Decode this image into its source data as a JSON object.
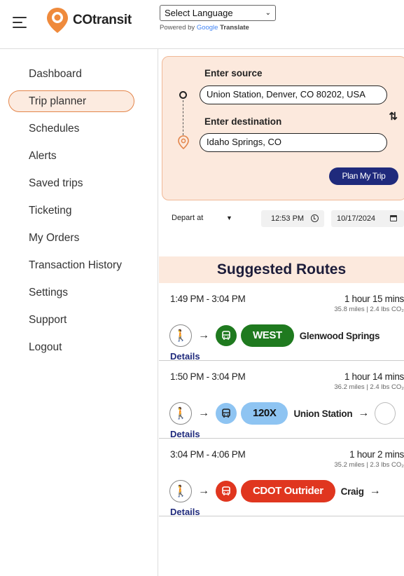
{
  "header": {
    "brand": "COtransit",
    "language_select": "Select Language",
    "powered_by": "Powered by",
    "google": "Google",
    "translate": "Translate"
  },
  "sidebar": {
    "items": [
      {
        "label": "Dashboard"
      },
      {
        "label": "Trip planner",
        "active": true
      },
      {
        "label": "Schedules"
      },
      {
        "label": "Alerts"
      },
      {
        "label": "Saved trips"
      },
      {
        "label": "Ticketing"
      },
      {
        "label": "My Orders"
      },
      {
        "label": "Transaction History"
      },
      {
        "label": "Settings"
      },
      {
        "label": "Support"
      },
      {
        "label": "Logout"
      }
    ]
  },
  "planner": {
    "source_label": "Enter source",
    "source_value": "Union Station, Denver, CO 80202, USA",
    "destination_label": "Enter destination",
    "destination_value": "Idaho Springs, CO",
    "swap_icon": "⇅",
    "plan_button": "Plan My Trip",
    "depart_option": "Depart at",
    "time": "12:53 PM",
    "date": "10/17/2024"
  },
  "suggested_title": "Suggested Routes",
  "routes": [
    {
      "time": "1:49 PM - 3:04 PM",
      "duration": "1 hour 15 mins",
      "meta": "35.8 miles | 2.4 lbs CO₂",
      "route_name": "WEST",
      "pill_color": "#1f7a1f",
      "pill_text_color": "#ffffff",
      "bus_color": "#1f7a1f",
      "destination": "Glenwood Springs",
      "details": "Details"
    },
    {
      "time": "1:50 PM - 3:04 PM",
      "duration": "1 hour 14 mins",
      "meta": "36.2 miles | 2.4 lbs CO₂",
      "route_name": "120X",
      "pill_color": "#8ec4f2",
      "pill_text_color": "#111111",
      "bus_color": "#8ec4f2",
      "destination": "Union Station",
      "details": "Details"
    },
    {
      "time": "3:04 PM - 4:06 PM",
      "duration": "1 hour 2 mins",
      "meta": "35.2 miles | 2.3 lbs CO₂",
      "route_name": "CDOT Outrider",
      "pill_color": "#e0361f",
      "pill_text_color": "#ffffff",
      "bus_color": "#e0361f",
      "destination": "Craig",
      "details": "Details"
    }
  ],
  "colors": {
    "accent_orange": "#e3854a",
    "panel_bg": "#fce9dd",
    "button_navy": "#1f2a7c"
  }
}
